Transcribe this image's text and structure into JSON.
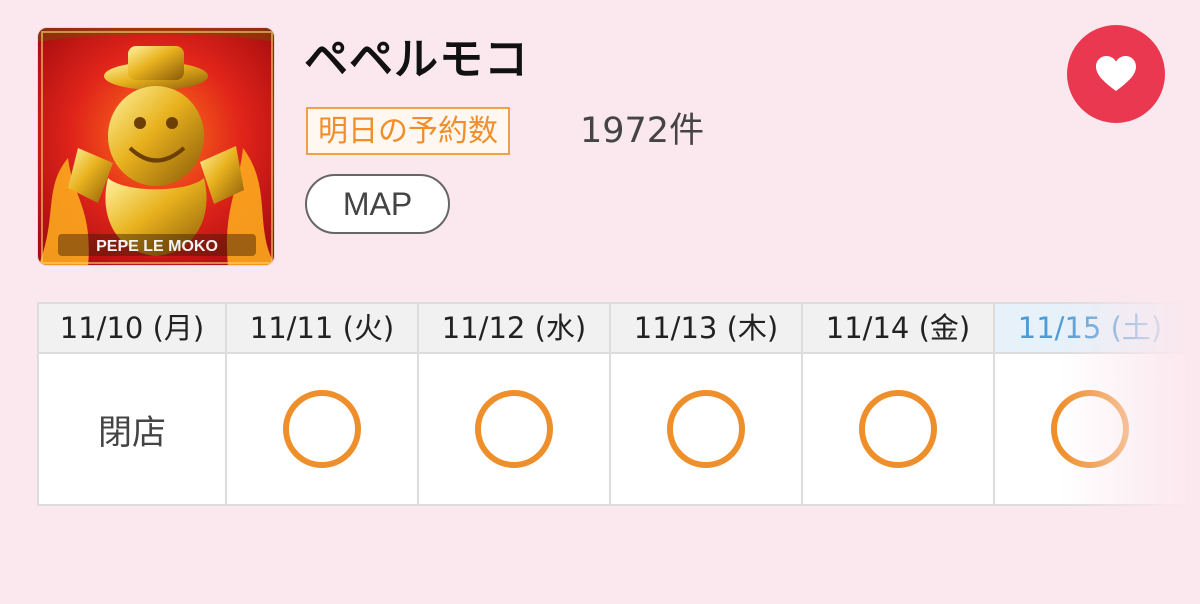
{
  "shop": {
    "name": "ペペルモコ",
    "thumbnail_logo_text": "PEPE LE MOKO",
    "reservation_label": "明日の予約数",
    "reservation_count": "1972件",
    "map_label": "MAP",
    "favorite_icon": "heart-icon"
  },
  "calendar": {
    "days": [
      {
        "date": "11/10 (月)",
        "status": "閉店"
      },
      {
        "date": "11/11 (火)",
        "status": "○"
      },
      {
        "date": "11/12 (水)",
        "status": "○"
      },
      {
        "date": "11/13 (木)",
        "status": "○"
      },
      {
        "date": "11/14 (金)",
        "status": "○"
      },
      {
        "date": "11/15 (土)",
        "status": "○"
      }
    ]
  },
  "colors": {
    "background": "#fbe8ee",
    "accent_orange": "#ee8f2c",
    "favorite_red": "#e9384f",
    "saturday_blue": "#4d9bd6"
  }
}
